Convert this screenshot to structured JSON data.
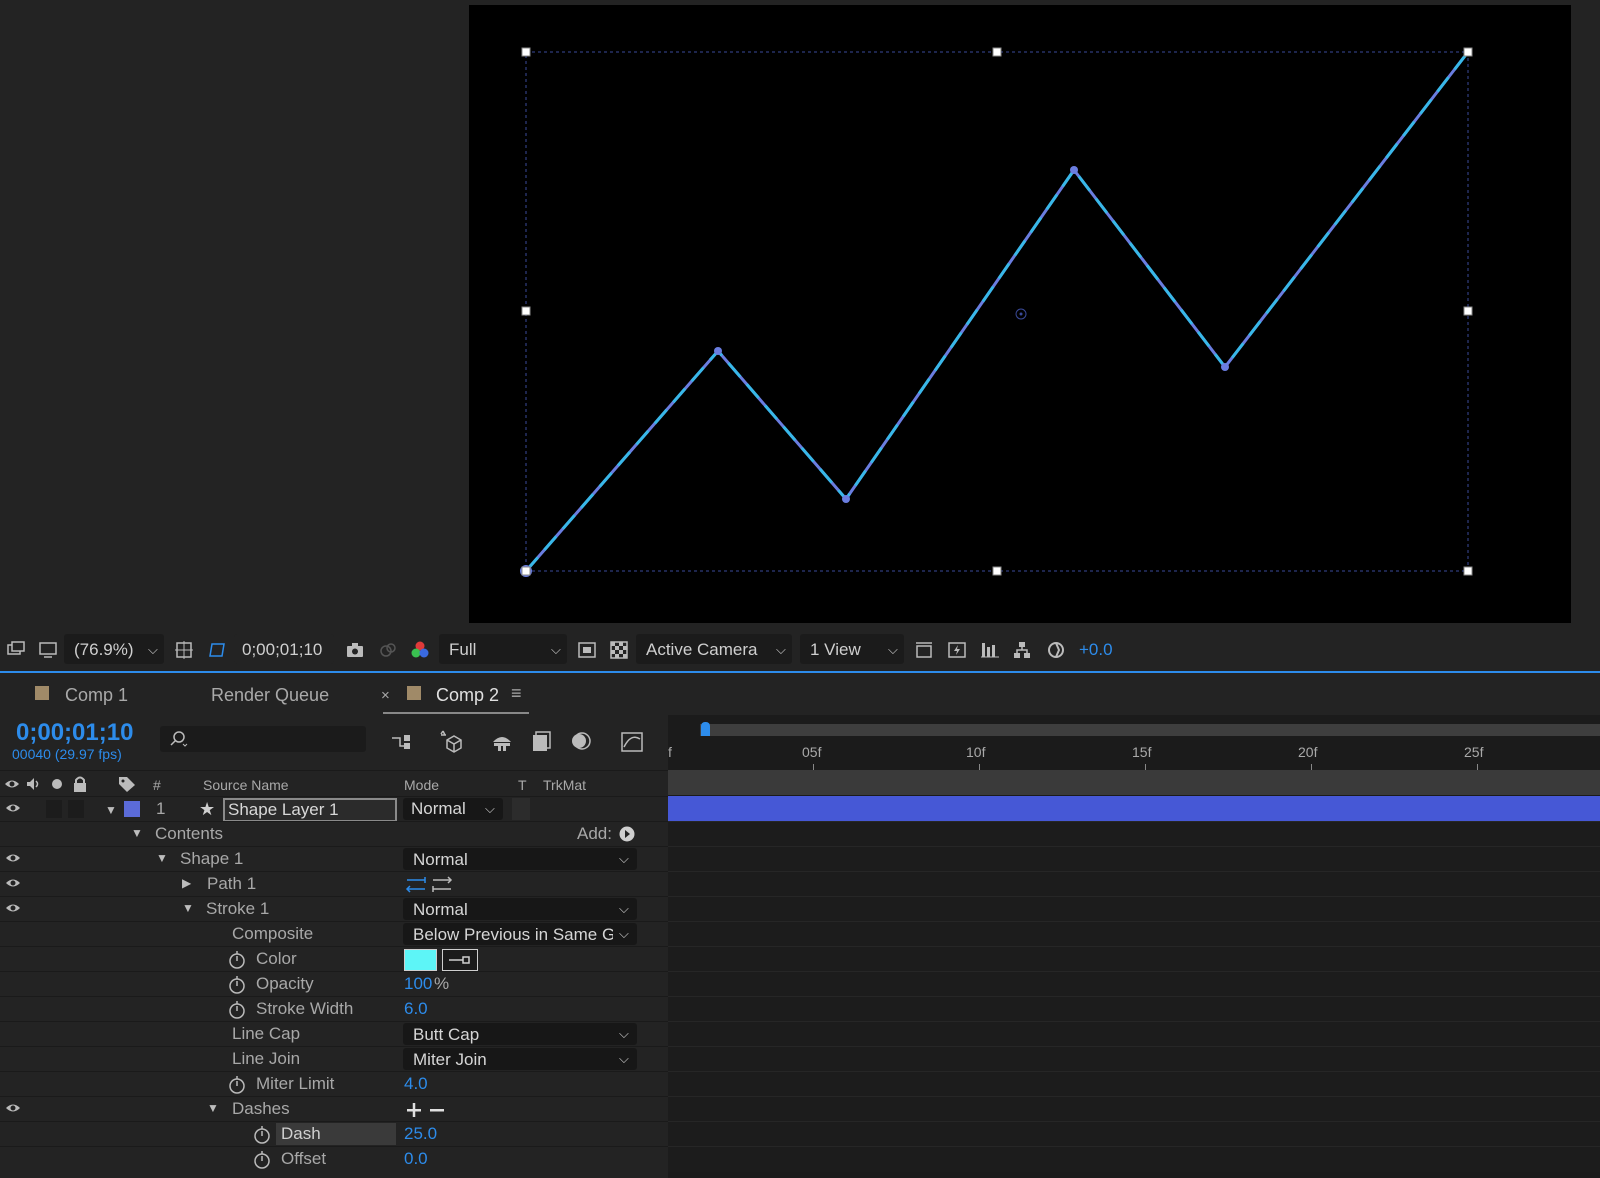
{
  "viewer_toolbar": {
    "zoom": "(76.9%)",
    "timecode": "0;00;01;10",
    "resolution": "Full",
    "camera": "Active Camera",
    "views": "1 View",
    "exposure": "+0.0"
  },
  "tabs": [
    {
      "label": "Comp 1"
    },
    {
      "label": "Render Queue"
    },
    {
      "label": "Comp 2"
    }
  ],
  "timeline": {
    "timecode": "0;00;01;10",
    "frame_info": "00040 (29.97 fps)",
    "ruler_labels": [
      "f",
      "05f",
      "10f",
      "15f",
      "20f",
      "25f"
    ]
  },
  "columns": {
    "num": "#",
    "source_name": "Source Name",
    "mode": "Mode",
    "t": "T",
    "trkmat": "TrkMat"
  },
  "layer": {
    "index": "1",
    "name": "Shape Layer 1",
    "mode": "Normal"
  },
  "props": {
    "contents": "Contents",
    "add": "Add:",
    "shape1": "Shape 1",
    "shape1_mode": "Normal",
    "path1": "Path 1",
    "stroke1": "Stroke 1",
    "stroke1_mode": "Normal",
    "composite": "Composite",
    "composite_value": "Below Previous in Same G",
    "color": "Color",
    "color_value": "#5df5f7",
    "opacity": "Opacity",
    "opacity_value": "100",
    "opacity_unit": "%",
    "stroke_width": "Stroke Width",
    "stroke_width_value": "6.0",
    "line_cap": "Line Cap",
    "line_cap_value": "Butt Cap",
    "line_join": "Line Join",
    "line_join_value": "Miter Join",
    "miter_limit": "Miter Limit",
    "miter_limit_value": "4.0",
    "dashes": "Dashes",
    "dash": "Dash",
    "dash_value": "25.0",
    "offset": "Offset",
    "offset_value": "0.0"
  },
  "colors": {
    "accent": "#2d8ceb",
    "path_stroke": "#6a7de0",
    "dash_stroke": "#38b8e8",
    "layer_bar": "#4658d6",
    "label_swatch": "#5b6bd8"
  }
}
